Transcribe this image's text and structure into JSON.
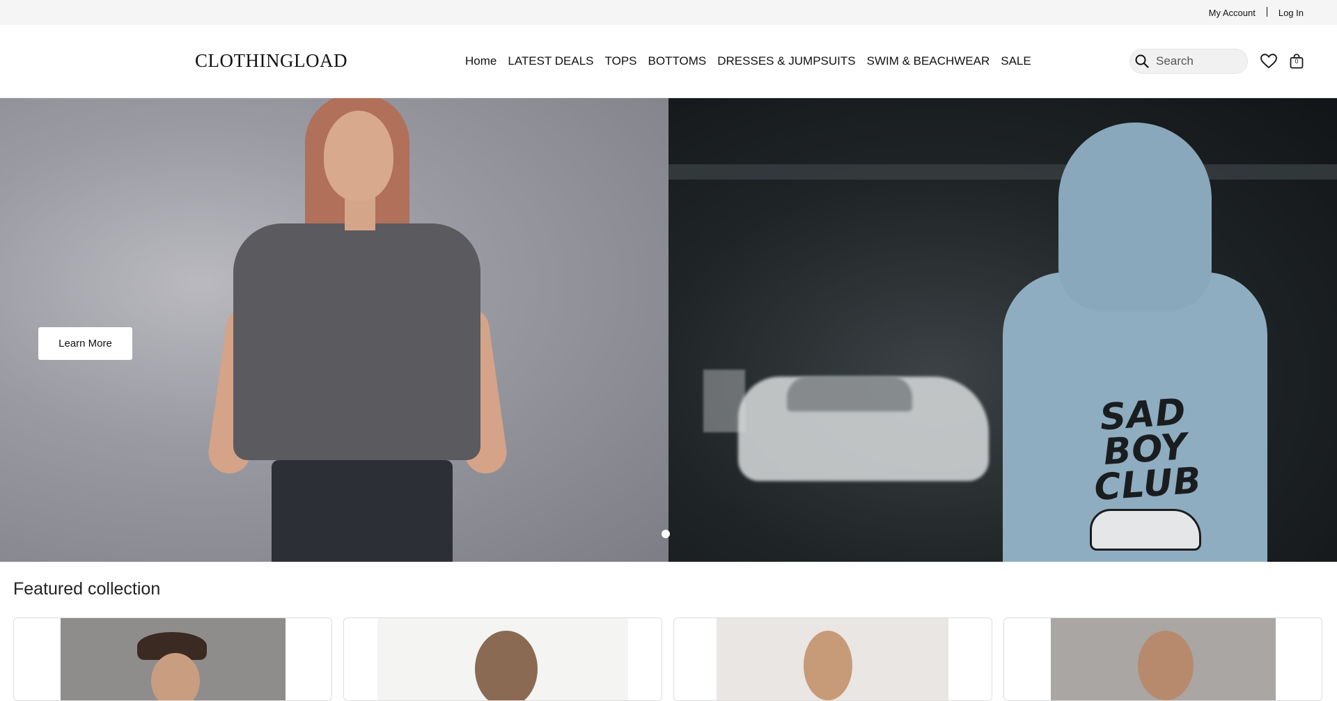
{
  "utility": {
    "my_account": "My Account",
    "log_in": "Log In"
  },
  "header": {
    "logo": "CLOTHINGLOAD",
    "nav": [
      "Home",
      "LATEST DEALS",
      "TOPS",
      "BOTTOMS",
      "DRESSES & JUMPSUITS",
      "SWIM & BEACHWEAR",
      "SALE"
    ],
    "search_placeholder": "Search",
    "cart_count": "0",
    "icons": [
      "search-icon",
      "heart-icon",
      "shopping-bag-icon"
    ]
  },
  "hero": {
    "button_label": "Learn More",
    "hoodie_print": "SAD BOY CLUB",
    "slides_count": 1
  },
  "featured": {
    "title": "Featured collection"
  },
  "colors": {
    "utility_bg": "#f5f5f5",
    "hoodie_blue": "#8fadc0",
    "shirt_gray": "#5a5a5f"
  }
}
